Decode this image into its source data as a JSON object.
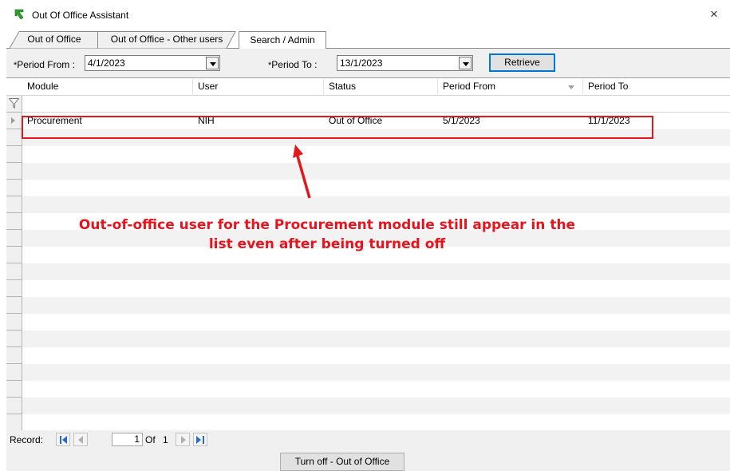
{
  "window": {
    "title": "Out Of Office Assistant",
    "close_glyph": "×"
  },
  "tabs": [
    {
      "label": "Out of Office",
      "active": false
    },
    {
      "label": "Out of Office - Other users",
      "active": false
    },
    {
      "label": "Search / Admin",
      "active": true
    }
  ],
  "filters": {
    "period_from": {
      "label": "Period From :",
      "required_mark": "*",
      "value": "4/1/2023"
    },
    "period_to": {
      "label": "Period To :",
      "required_mark": "*",
      "value": "13/1/2023"
    },
    "retrieve_label": "Retrieve"
  },
  "grid": {
    "columns": [
      "Module",
      "User",
      "Status",
      "Period From",
      "Period To"
    ],
    "sorted_column": "Period From",
    "rows": [
      {
        "module": "Procurement",
        "user": "NIH",
        "status": "Out of Office",
        "period_from": "5/1/2023",
        "period_to": "11/1/2023"
      }
    ]
  },
  "annotation": {
    "line1": "Out-of-office user for the Procurement module still appear in the",
    "line2": "list even after being turned off",
    "color": "#e8131c"
  },
  "navigator": {
    "label": "Record:",
    "current_page": "1",
    "of_label": "Of",
    "total_pages": "1"
  },
  "actions": {
    "turn_off_label": "Turn off - Out of Office"
  },
  "icons": {
    "app": "green-arrow-icon",
    "close": "close-icon",
    "filter": "filter-funnel-icon"
  }
}
